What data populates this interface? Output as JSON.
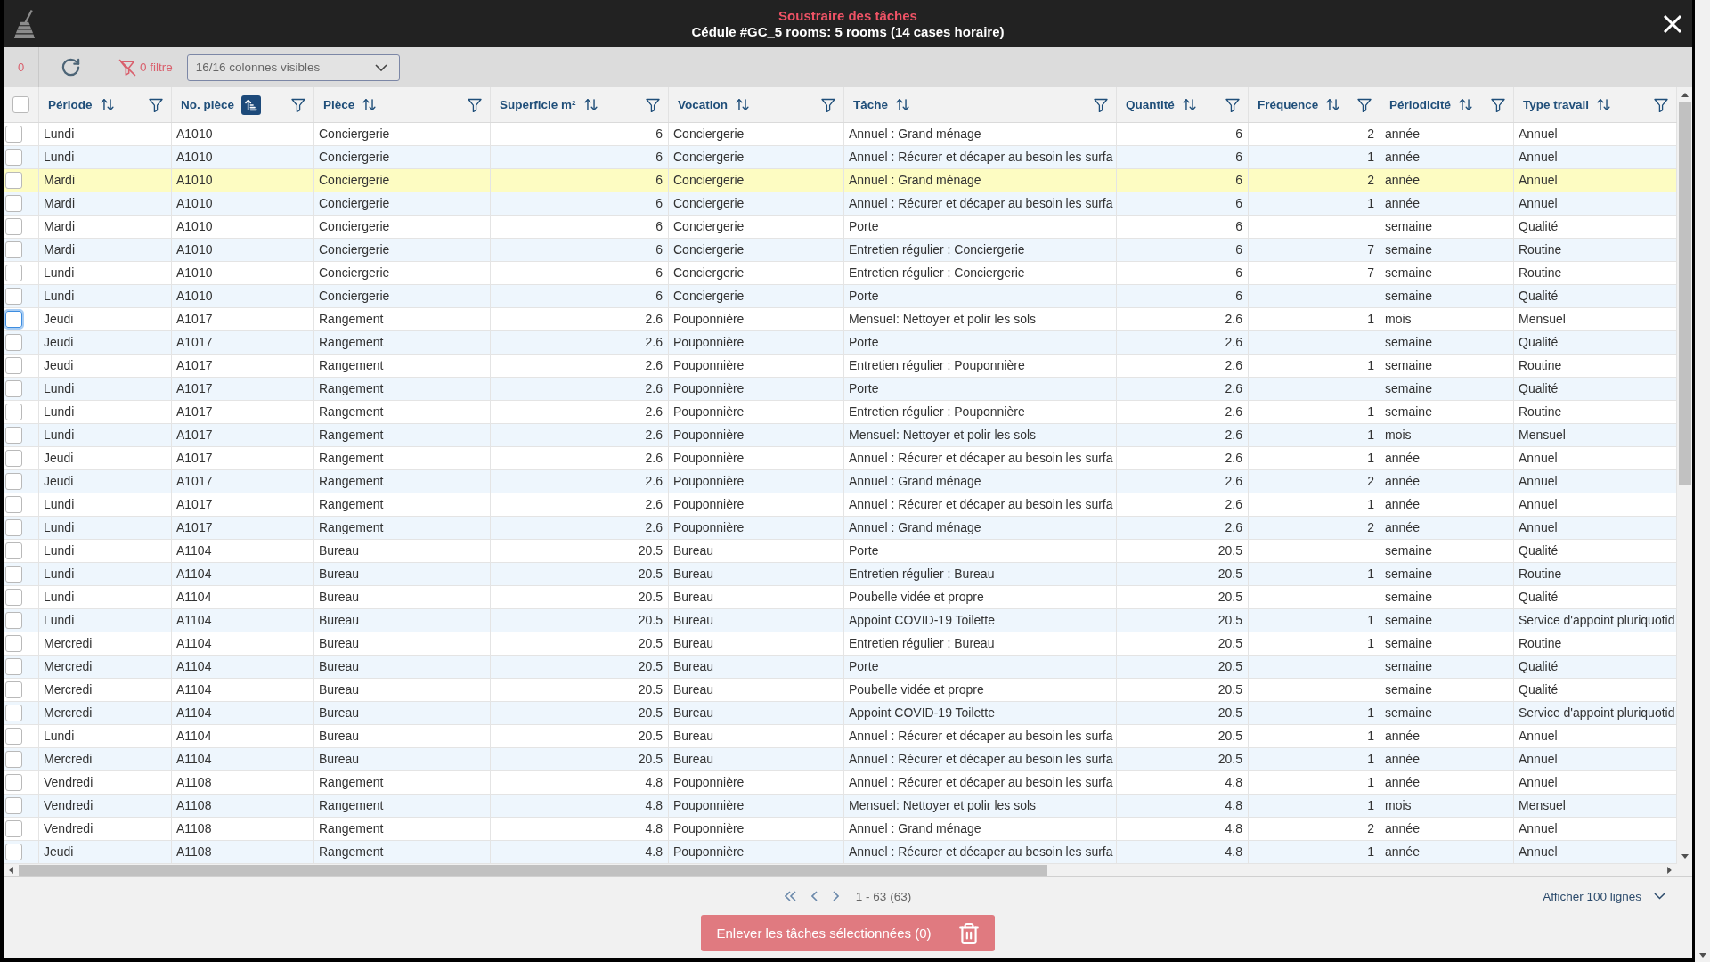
{
  "window": {
    "title": "Soustraire des tâches",
    "subtitle": "Cédule #GC_5 rooms: 5 rooms (14 cases horaire)"
  },
  "toolbar": {
    "selection_count": {
      "text": "0",
      "disabled": true
    },
    "filter_button": {
      "label": "0 filtre",
      "disabled": true
    },
    "columns_dropdown": {
      "value": "16/16 colonnes visibles"
    }
  },
  "table": {
    "select_all": {
      "checked": false
    },
    "columns": [
      {
        "label": "Période",
        "sorted": false,
        "kind": "text"
      },
      {
        "label": "No. pièce",
        "sorted": true,
        "kind": "text"
      },
      {
        "label": "Pièce",
        "sorted": false,
        "kind": "text"
      },
      {
        "label": "Superficie m²",
        "sorted": false,
        "kind": "number"
      },
      {
        "label": "Vocation",
        "sorted": false,
        "kind": "text"
      },
      {
        "label": "Tâche",
        "sorted": false,
        "kind": "text"
      },
      {
        "label": "Quantité",
        "sorted": false,
        "kind": "number"
      },
      {
        "label": "Fréquence",
        "sorted": false,
        "kind": "number"
      },
      {
        "label": "Périodicité",
        "sorted": false,
        "kind": "text"
      },
      {
        "label": "Type travail",
        "sorted": false,
        "kind": "text"
      }
    ],
    "rows": [
      {
        "checked": false,
        "focused": false,
        "highlighted": false,
        "cells": [
          "Lundi",
          "A1010",
          "Conciergerie",
          "6",
          "Conciergerie",
          "Annuel : Grand ménage",
          "6",
          "2",
          "année",
          "Annuel"
        ]
      },
      {
        "checked": false,
        "focused": false,
        "highlighted": false,
        "cells": [
          "Lundi",
          "A1010",
          "Conciergerie",
          "6",
          "Conciergerie",
          "Annuel : Récurer et décaper au besoin les surfa",
          "6",
          "1",
          "année",
          "Annuel"
        ]
      },
      {
        "checked": false,
        "focused": false,
        "highlighted": true,
        "cells": [
          "Mardi",
          "A1010",
          "Conciergerie",
          "6",
          "Conciergerie",
          "Annuel : Grand ménage",
          "6",
          "2",
          "année",
          "Annuel"
        ]
      },
      {
        "checked": false,
        "focused": false,
        "highlighted": false,
        "cells": [
          "Mardi",
          "A1010",
          "Conciergerie",
          "6",
          "Conciergerie",
          "Annuel : Récurer et décaper au besoin les surfa",
          "6",
          "1",
          "année",
          "Annuel"
        ]
      },
      {
        "checked": false,
        "focused": false,
        "highlighted": false,
        "cells": [
          "Mardi",
          "A1010",
          "Conciergerie",
          "6",
          "Conciergerie",
          "Porte",
          "6",
          null,
          "semaine",
          "Qualité"
        ]
      },
      {
        "checked": false,
        "focused": false,
        "highlighted": false,
        "cells": [
          "Mardi",
          "A1010",
          "Conciergerie",
          "6",
          "Conciergerie",
          "Entretien régulier : Conciergerie",
          "6",
          "7",
          "semaine",
          "Routine"
        ]
      },
      {
        "checked": false,
        "focused": false,
        "highlighted": false,
        "cells": [
          "Lundi",
          "A1010",
          "Conciergerie",
          "6",
          "Conciergerie",
          "Entretien régulier : Conciergerie",
          "6",
          "7",
          "semaine",
          "Routine"
        ]
      },
      {
        "checked": false,
        "focused": false,
        "highlighted": false,
        "cells": [
          "Lundi",
          "A1010",
          "Conciergerie",
          "6",
          "Conciergerie",
          "Porte",
          "6",
          null,
          "semaine",
          "Qualité"
        ]
      },
      {
        "checked": false,
        "focused": true,
        "highlighted": false,
        "cells": [
          "Jeudi",
          "A1017",
          "Rangement",
          "2.6",
          "Pouponnière",
          "Mensuel: Nettoyer et polir les sols",
          "2.6",
          "1",
          "mois",
          "Mensuel"
        ]
      },
      {
        "checked": false,
        "focused": false,
        "highlighted": false,
        "cells": [
          "Jeudi",
          "A1017",
          "Rangement",
          "2.6",
          "Pouponnière",
          "Porte",
          "2.6",
          null,
          "semaine",
          "Qualité"
        ]
      },
      {
        "checked": false,
        "focused": false,
        "highlighted": false,
        "cells": [
          "Jeudi",
          "A1017",
          "Rangement",
          "2.6",
          "Pouponnière",
          "Entretien régulier : Pouponnière",
          "2.6",
          "1",
          "semaine",
          "Routine"
        ]
      },
      {
        "checked": false,
        "focused": false,
        "highlighted": false,
        "cells": [
          "Lundi",
          "A1017",
          "Rangement",
          "2.6",
          "Pouponnière",
          "Porte",
          "2.6",
          null,
          "semaine",
          "Qualité"
        ]
      },
      {
        "checked": false,
        "focused": false,
        "highlighted": false,
        "cells": [
          "Lundi",
          "A1017",
          "Rangement",
          "2.6",
          "Pouponnière",
          "Entretien régulier : Pouponnière",
          "2.6",
          "1",
          "semaine",
          "Routine"
        ]
      },
      {
        "checked": false,
        "focused": false,
        "highlighted": false,
        "cells": [
          "Lundi",
          "A1017",
          "Rangement",
          "2.6",
          "Pouponnière",
          "Mensuel: Nettoyer et polir les sols",
          "2.6",
          "1",
          "mois",
          "Mensuel"
        ]
      },
      {
        "checked": false,
        "focused": false,
        "highlighted": false,
        "cells": [
          "Jeudi",
          "A1017",
          "Rangement",
          "2.6",
          "Pouponnière",
          "Annuel : Récurer et décaper au besoin les surfa",
          "2.6",
          "1",
          "année",
          "Annuel"
        ]
      },
      {
        "checked": false,
        "focused": false,
        "highlighted": false,
        "cells": [
          "Jeudi",
          "A1017",
          "Rangement",
          "2.6",
          "Pouponnière",
          "Annuel : Grand ménage",
          "2.6",
          "2",
          "année",
          "Annuel"
        ]
      },
      {
        "checked": false,
        "focused": false,
        "highlighted": false,
        "cells": [
          "Lundi",
          "A1017",
          "Rangement",
          "2.6",
          "Pouponnière",
          "Annuel : Récurer et décaper au besoin les surfa",
          "2.6",
          "1",
          "année",
          "Annuel"
        ]
      },
      {
        "checked": false,
        "focused": false,
        "highlighted": false,
        "cells": [
          "Lundi",
          "A1017",
          "Rangement",
          "2.6",
          "Pouponnière",
          "Annuel : Grand ménage",
          "2.6",
          "2",
          "année",
          "Annuel"
        ]
      },
      {
        "checked": false,
        "focused": false,
        "highlighted": false,
        "cells": [
          "Lundi",
          "A1104",
          "Bureau",
          "20.5",
          "Bureau",
          "Porte",
          "20.5",
          null,
          "semaine",
          "Qualité"
        ]
      },
      {
        "checked": false,
        "focused": false,
        "highlighted": false,
        "cells": [
          "Lundi",
          "A1104",
          "Bureau",
          "20.5",
          "Bureau",
          "Entretien régulier : Bureau",
          "20.5",
          "1",
          "semaine",
          "Routine"
        ]
      },
      {
        "checked": false,
        "focused": false,
        "highlighted": false,
        "cells": [
          "Lundi",
          "A1104",
          "Bureau",
          "20.5",
          "Bureau",
          "Poubelle vidée et propre",
          "20.5",
          null,
          "semaine",
          "Qualité"
        ]
      },
      {
        "checked": false,
        "focused": false,
        "highlighted": false,
        "cells": [
          "Lundi",
          "A1104",
          "Bureau",
          "20.5",
          "Bureau",
          "Appoint COVID-19 Toilette",
          "20.5",
          "1",
          "semaine",
          "Service d'appoint pluriquotid"
        ]
      },
      {
        "checked": false,
        "focused": false,
        "highlighted": false,
        "cells": [
          "Mercredi",
          "A1104",
          "Bureau",
          "20.5",
          "Bureau",
          "Entretien régulier : Bureau",
          "20.5",
          "1",
          "semaine",
          "Routine"
        ]
      },
      {
        "checked": false,
        "focused": false,
        "highlighted": false,
        "cells": [
          "Mercredi",
          "A1104",
          "Bureau",
          "20.5",
          "Bureau",
          "Porte",
          "20.5",
          null,
          "semaine",
          "Qualité"
        ]
      },
      {
        "checked": false,
        "focused": false,
        "highlighted": false,
        "cells": [
          "Mercredi",
          "A1104",
          "Bureau",
          "20.5",
          "Bureau",
          "Poubelle vidée et propre",
          "20.5",
          null,
          "semaine",
          "Qualité"
        ]
      },
      {
        "checked": false,
        "focused": false,
        "highlighted": false,
        "cells": [
          "Mercredi",
          "A1104",
          "Bureau",
          "20.5",
          "Bureau",
          "Appoint COVID-19 Toilette",
          "20.5",
          "1",
          "semaine",
          "Service d'appoint pluriquotid"
        ]
      },
      {
        "checked": false,
        "focused": false,
        "highlighted": false,
        "cells": [
          "Lundi",
          "A1104",
          "Bureau",
          "20.5",
          "Bureau",
          "Annuel : Récurer et décaper au besoin les surfa",
          "20.5",
          "1",
          "année",
          "Annuel"
        ]
      },
      {
        "checked": false,
        "focused": false,
        "highlighted": false,
        "cells": [
          "Mercredi",
          "A1104",
          "Bureau",
          "20.5",
          "Bureau",
          "Annuel : Récurer et décaper au besoin les surfa",
          "20.5",
          "1",
          "année",
          "Annuel"
        ]
      },
      {
        "checked": false,
        "focused": false,
        "highlighted": false,
        "cells": [
          "Vendredi",
          "A1108",
          "Rangement",
          "4.8",
          "Pouponnière",
          "Annuel : Récurer et décaper au besoin les surfa",
          "4.8",
          "1",
          "année",
          "Annuel"
        ]
      },
      {
        "checked": false,
        "focused": false,
        "highlighted": false,
        "cells": [
          "Vendredi",
          "A1108",
          "Rangement",
          "4.8",
          "Pouponnière",
          "Mensuel: Nettoyer et polir les sols",
          "4.8",
          "1",
          "mois",
          "Mensuel"
        ]
      },
      {
        "checked": false,
        "focused": false,
        "highlighted": false,
        "cells": [
          "Vendredi",
          "A1108",
          "Rangement",
          "4.8",
          "Pouponnière",
          "Annuel : Grand ménage",
          "4.8",
          "2",
          "année",
          "Annuel"
        ]
      },
      {
        "checked": false,
        "focused": false,
        "highlighted": false,
        "cells": [
          "Jeudi",
          "A1108",
          "Rangement",
          "4.8",
          "Pouponnière",
          "Annuel : Récurer et décaper au besoin les surfa",
          "4.8",
          "1",
          "année",
          "Annuel"
        ]
      }
    ]
  },
  "pagination": {
    "range": "1 - 63 (63)",
    "page_size": "Afficher 100 lignes"
  },
  "remove_button": {
    "label": "Enlever les tâches sélectionnées (0)",
    "disabled": true
  }
}
